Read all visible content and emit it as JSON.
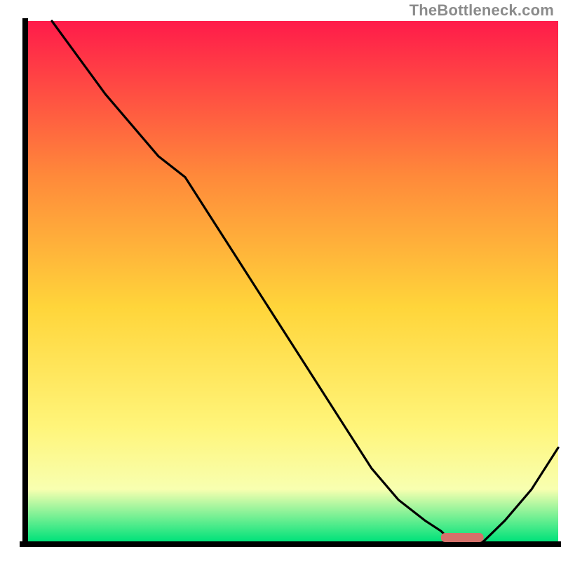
{
  "watermark": "TheBottleneck.com",
  "chart_data": {
    "type": "line",
    "title": "",
    "xlabel": "",
    "ylabel": "",
    "xlim": [
      0,
      100
    ],
    "ylim": [
      0,
      100
    ],
    "grid": false,
    "legend": false,
    "series": [
      {
        "name": "bottleneck-curve",
        "x": [
          5,
          10,
          15,
          20,
          25,
          30,
          35,
          40,
          45,
          50,
          55,
          60,
          65,
          70,
          75,
          78,
          80,
          82,
          84,
          86,
          90,
          95,
          100
        ],
        "y": [
          100,
          93,
          86,
          80,
          74,
          70,
          62,
          54,
          46,
          38,
          30,
          22,
          14,
          8,
          4,
          2,
          0,
          0,
          0,
          0,
          4,
          10,
          18
        ]
      }
    ],
    "optimum_marker": {
      "x_start": 78,
      "x_end": 86,
      "y": 0,
      "color": "#d5716a"
    },
    "background_gradient": {
      "top": "#ff1b4a",
      "mid_upper": "#ff8a3a",
      "mid": "#ffd53a",
      "mid_lower": "#fff57a",
      "lower": "#f8ffb0",
      "bottom": "#00e27a"
    },
    "axis_color": "#000000",
    "curve_color": "#000000"
  }
}
